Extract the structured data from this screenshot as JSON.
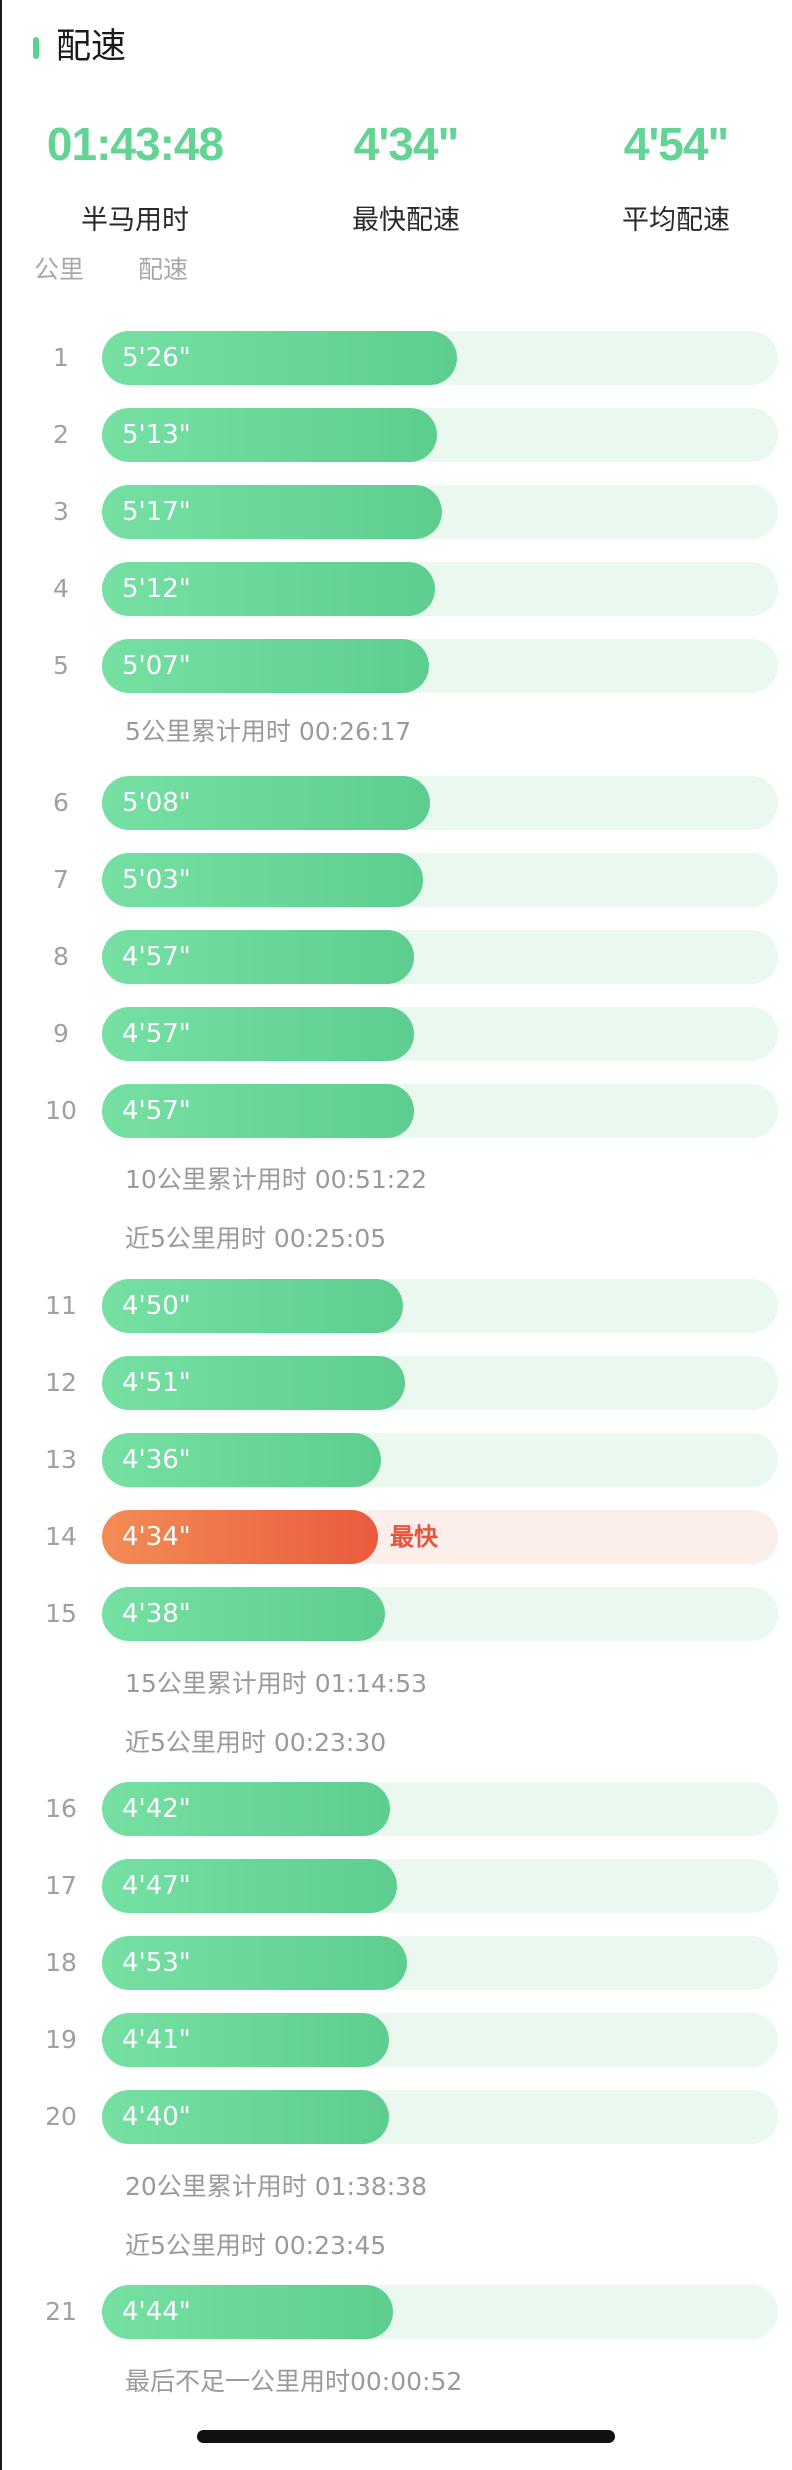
{
  "header": {
    "title": "配速"
  },
  "stats": [
    {
      "value": "01:43:48",
      "label": "半马用时"
    },
    {
      "value": "4'34\"",
      "label": "最快配速"
    },
    {
      "value": "4'54\"",
      "label": "平均配速"
    }
  ],
  "columns": {
    "km": "公里",
    "pace": "配速"
  },
  "fastest_tag": "最快",
  "colors": {
    "bar": "#5dce8f",
    "track": "#eaf8f0",
    "fastest_bar": "#ea5a3c",
    "fastest_track": "#fcefeb",
    "accent": "#64d495"
  },
  "splits": [
    {
      "km": "1",
      "pace": "5'26\"",
      "fraction": 0.525
    },
    {
      "km": "2",
      "pace": "5'13\"",
      "fraction": 0.495
    },
    {
      "km": "3",
      "pace": "5'17\"",
      "fraction": 0.503
    },
    {
      "km": "4",
      "pace": "5'12\"",
      "fraction": 0.493
    },
    {
      "km": "5",
      "pace": "5'07\"",
      "fraction": 0.483
    },
    {
      "km": "6",
      "pace": "5'08\"",
      "fraction": 0.485
    },
    {
      "km": "7",
      "pace": "5'03\"",
      "fraction": 0.475
    },
    {
      "km": "8",
      "pace": "4'57\"",
      "fraction": 0.461
    },
    {
      "km": "9",
      "pace": "4'57\"",
      "fraction": 0.461
    },
    {
      "km": "10",
      "pace": "4'57\"",
      "fraction": 0.461
    },
    {
      "km": "11",
      "pace": "4'50\"",
      "fraction": 0.446
    },
    {
      "km": "12",
      "pace": "4'51\"",
      "fraction": 0.448
    },
    {
      "km": "13",
      "pace": "4'36\"",
      "fraction": 0.413
    },
    {
      "km": "14",
      "pace": "4'34\"",
      "fraction": 0.408,
      "fastest": true
    },
    {
      "km": "15",
      "pace": "4'38\"",
      "fraction": 0.419
    },
    {
      "km": "16",
      "pace": "4'42\"",
      "fraction": 0.426
    },
    {
      "km": "17",
      "pace": "4'47\"",
      "fraction": 0.436
    },
    {
      "km": "18",
      "pace": "4'53\"",
      "fraction": 0.451
    },
    {
      "km": "19",
      "pace": "4'41\"",
      "fraction": 0.424
    },
    {
      "km": "20",
      "pace": "4'40\"",
      "fraction": 0.424
    },
    {
      "km": "21",
      "pace": "4'44\"",
      "fraction": 0.431
    }
  ],
  "notes": {
    "after5": [
      "5公里累计用时 00:26:17"
    ],
    "after10": [
      "10公里累计用时 00:51:22",
      "近5公里用时 00:25:05"
    ],
    "after15": [
      "15公里累计用时 01:14:53",
      "近5公里用时 00:23:30"
    ],
    "after20": [
      "20公里累计用时 01:38:38",
      "近5公里用时 00:23:45"
    ],
    "after21": [
      "最后不足一公里用时00:00:52"
    ]
  }
}
